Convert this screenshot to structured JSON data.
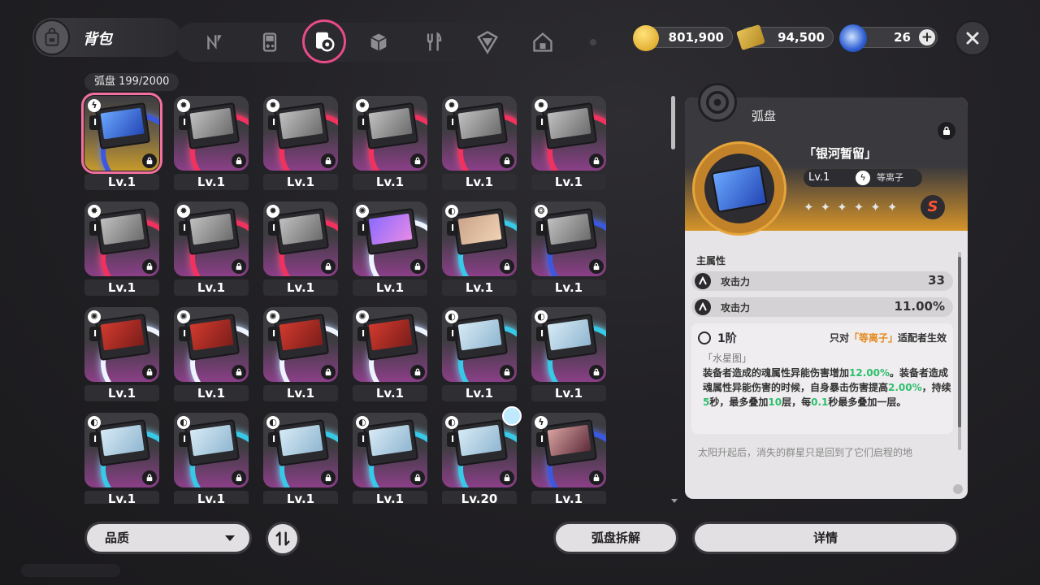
{
  "header": {
    "bag_title": "背包",
    "tabs": [
      {
        "icon": "n-logo-icon"
      },
      {
        "icon": "gameboy-icon"
      },
      {
        "icon": "disc-drive-icon",
        "active": true
      },
      {
        "icon": "cube-icon"
      },
      {
        "icon": "fork-knife-icon"
      },
      {
        "icon": "box-icon"
      },
      {
        "icon": "home-icon"
      }
    ],
    "currencies": [
      {
        "icon": "gold-egg-icon",
        "value": "801,900"
      },
      {
        "icon": "ticket-icon",
        "value": "94,500"
      },
      {
        "icon": "blue-crystal-icon",
        "value": "26"
      }
    ]
  },
  "inventory": {
    "count_label": "弧盘  199/2000",
    "items": [
      {
        "level": "Lv.1",
        "selected": true,
        "frame": "gold",
        "ring": "blue",
        "art": "a1",
        "elem": "ϟ"
      },
      {
        "level": "Lv.1",
        "ring": "red",
        "art": "a5",
        "elem": "✹"
      },
      {
        "level": "Lv.1",
        "ring": "red",
        "art": "a5",
        "elem": "✹"
      },
      {
        "level": "Lv.1",
        "ring": "red",
        "art": "a5",
        "elem": "✹"
      },
      {
        "level": "Lv.1",
        "ring": "red",
        "art": "a5",
        "elem": "✹"
      },
      {
        "level": "Lv.1",
        "ring": "red",
        "art": "a5",
        "elem": "✹"
      },
      {
        "level": "Lv.1",
        "ring": "red",
        "art": "a5",
        "elem": "✹"
      },
      {
        "level": "Lv.1",
        "ring": "red",
        "art": "a5",
        "elem": "✹"
      },
      {
        "level": "Lv.1",
        "ring": "red",
        "art": "a5",
        "elem": "✹"
      },
      {
        "level": "Lv.1",
        "ring": "white",
        "art": "a3",
        "elem": "✺"
      },
      {
        "level": "Lv.1",
        "ring": "cyan",
        "art": "a4",
        "elem": "◐"
      },
      {
        "level": "Lv.1",
        "ring": "blue",
        "art": "a5",
        "elem": "❂"
      },
      {
        "level": "Lv.1",
        "ring": "white",
        "art": "a6",
        "elem": "✺"
      },
      {
        "level": "Lv.1",
        "ring": "white",
        "art": "a6",
        "elem": "✺"
      },
      {
        "level": "Lv.1",
        "ring": "white",
        "art": "a6",
        "elem": "✺"
      },
      {
        "level": "Lv.1",
        "ring": "white",
        "art": "a6",
        "elem": "✺"
      },
      {
        "level": "Lv.1",
        "ring": "cyan",
        "art": "a7",
        "elem": "◐"
      },
      {
        "level": "Lv.1",
        "ring": "cyan",
        "art": "a7",
        "elem": "◐"
      },
      {
        "level": "Lv.1",
        "ring": "cyan",
        "art": "a7",
        "elem": "◐"
      },
      {
        "level": "Lv.1",
        "ring": "cyan",
        "art": "a7",
        "elem": "◐"
      },
      {
        "level": "Lv.1",
        "ring": "cyan",
        "art": "a7",
        "elem": "◐"
      },
      {
        "level": "Lv.1",
        "ring": "cyan",
        "art": "a7",
        "elem": "◐"
      },
      {
        "level": "Lv.20",
        "ring": "cyan",
        "art": "a7",
        "elem": "◐",
        "equipped": true
      },
      {
        "level": "Lv.1",
        "ring": "blue",
        "art": "a8",
        "elem": "ϟ"
      }
    ]
  },
  "detail": {
    "category": "弧盘",
    "name": "「银河暂留」",
    "level": "Lv.1",
    "element": "等离子",
    "element_glyph": "ϟ",
    "stars": "✦✦✦✦✦✦",
    "rank_badge": "S",
    "main_attr_label": "主属性",
    "stats": [
      {
        "key": "攻击力",
        "value": "33"
      },
      {
        "key": "攻击力",
        "value": "11.00%"
      }
    ],
    "tier": "1阶",
    "only_prefix": "只对",
    "only_highlight": "「等离子」",
    "only_suffix": "适配者生效",
    "quote": "「水星图」",
    "desc_1": "装备者造成的魂属性异能伤害增加",
    "desc_v1": "12.00%",
    "desc_2": "。装备者造成魂属性异能伤害的时候，自身暴击伤害提高",
    "desc_v2": "2.00%",
    "desc_3": "，持续",
    "desc_v3": "5",
    "desc_4": "秒，最多叠加",
    "desc_v4": "10",
    "desc_5": "层，每",
    "desc_v5": "0.1",
    "desc_6": "秒最多叠加一层。",
    "lore": "太阳升起后，消失的群星只是回到了它们启程的地"
  },
  "footer": {
    "quality_label": "品质",
    "dismantle_label": "弧盘拆解",
    "detail_label": "详情"
  }
}
